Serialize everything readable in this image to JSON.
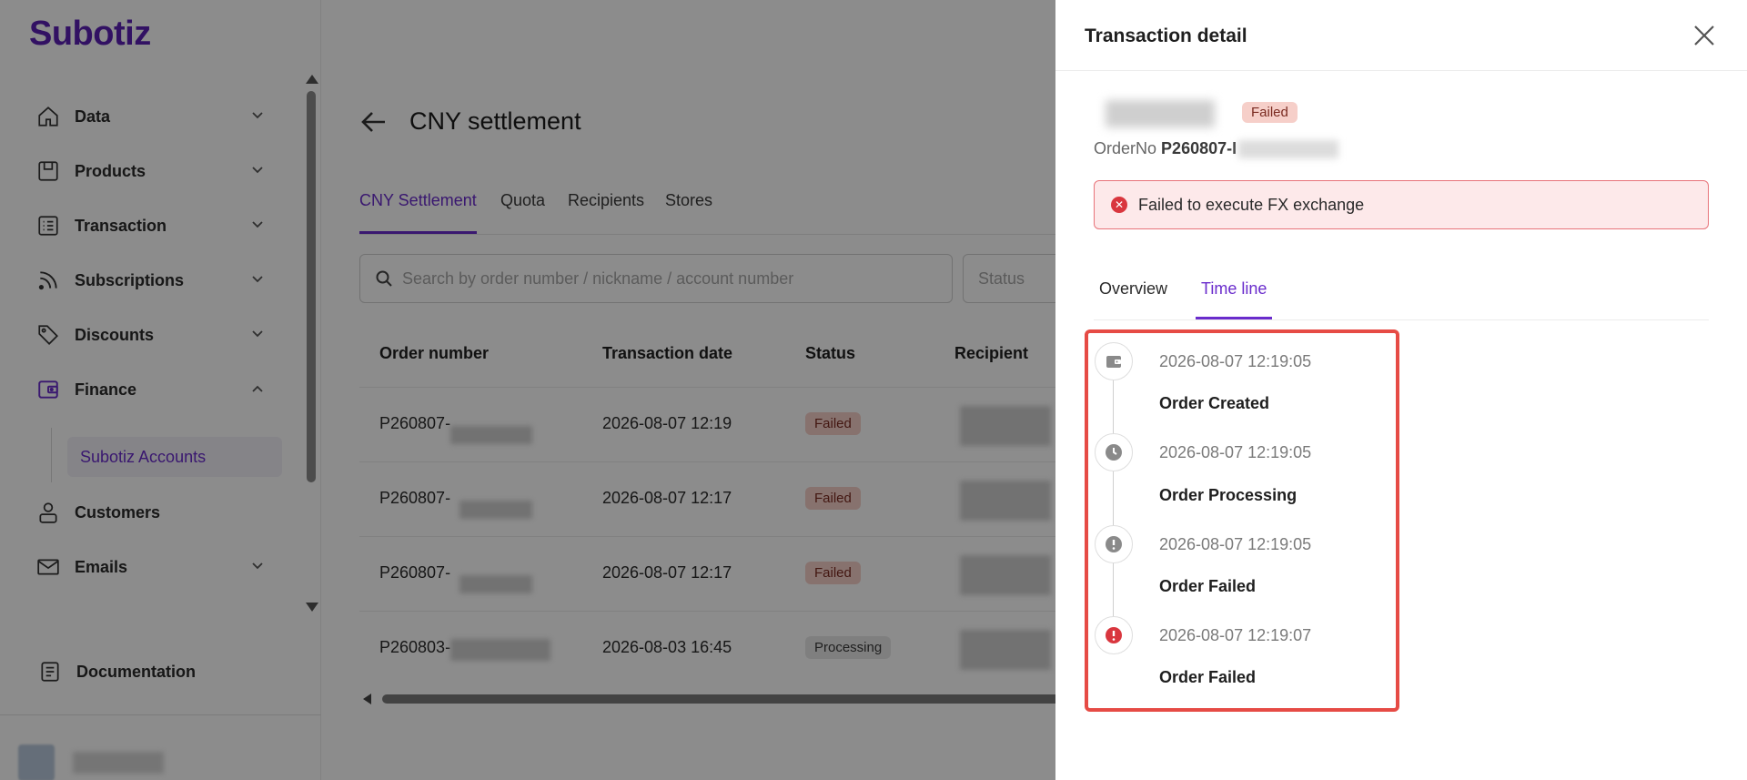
{
  "app": {
    "logo": "Subotiz"
  },
  "sidebar": {
    "items": [
      {
        "label": "Data",
        "icon": "home-icon"
      },
      {
        "label": "Products",
        "icon": "products-icon"
      },
      {
        "label": "Transaction",
        "icon": "list-icon"
      },
      {
        "label": "Subscriptions",
        "icon": "rss-icon"
      },
      {
        "label": "Discounts",
        "icon": "tag-icon"
      },
      {
        "label": "Finance",
        "icon": "wallet-icon"
      },
      {
        "label": "Customers",
        "icon": "user-icon"
      },
      {
        "label": "Emails",
        "icon": "mail-icon"
      },
      {
        "label": "Documentation",
        "icon": "document-icon"
      }
    ],
    "active_sub": "Subotiz Accounts"
  },
  "page": {
    "title": "CNY settlement",
    "tabs": [
      "CNY Settlement",
      "Quota",
      "Recipients",
      "Stores"
    ],
    "search_placeholder": "Search by order number / nickname / account number",
    "status_placeholder": "Status",
    "table": {
      "headers": [
        "Order number",
        "Transaction date",
        "Status",
        "Recipient"
      ],
      "rows": [
        {
          "order": "P260807-",
          "date": "2026-08-07 12:19",
          "status": "Failed"
        },
        {
          "order": "P260807-",
          "date": "2026-08-07 12:17",
          "status": "Failed"
        },
        {
          "order": "P260807-",
          "date": "2026-08-07 12:17",
          "status": "Failed"
        },
        {
          "order": "P260803-",
          "date": "2026-08-03 16:45",
          "status": "Processing"
        }
      ]
    }
  },
  "drawer": {
    "title": "Transaction detail",
    "status_badge": "Failed",
    "orderno_label": "OrderNo",
    "orderno_value": "P260807-I",
    "alert": "Failed to execute FX exchange",
    "tabs": [
      "Overview",
      "Time line"
    ],
    "timeline": [
      {
        "time": "2026-08-07 12:19:05",
        "label": "Order Created",
        "icon": "wallet-icon"
      },
      {
        "time": "2026-08-07 12:19:05",
        "label": "Order Processing",
        "icon": "clock-icon"
      },
      {
        "time": "2026-08-07 12:19:05",
        "label": "Order Failed",
        "icon": "exclamation-icon"
      },
      {
        "time": "2026-08-07 12:19:07",
        "label": "Order Failed",
        "icon": "error-icon"
      }
    ]
  },
  "colors": {
    "brand": "#5b1fb5",
    "accent": "#6a2ccc",
    "error": "#d9363e",
    "highlight_box": "#e64b45"
  }
}
